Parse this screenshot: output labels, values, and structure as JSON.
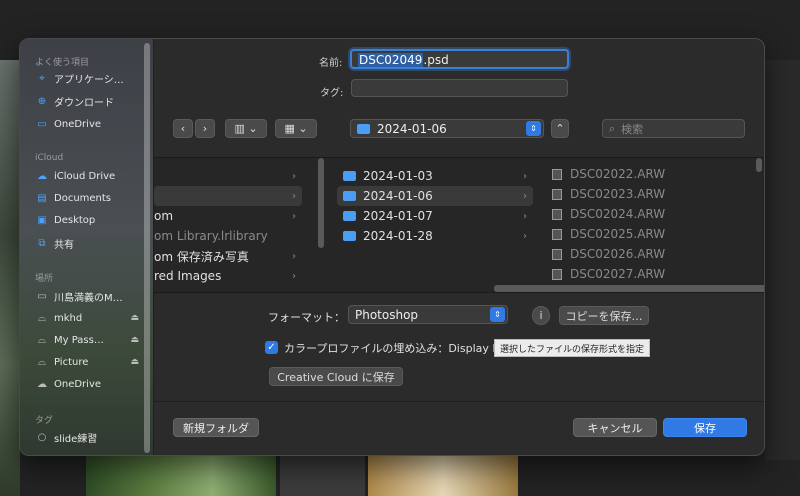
{
  "sidebar": {
    "favorites_title": "よく使う項目",
    "favorites": [
      {
        "label": "アプリケーシ…",
        "icon": "applications-icon"
      },
      {
        "label": "ダウンロード",
        "icon": "download-icon"
      },
      {
        "label": "OneDrive",
        "icon": "folder-icon"
      }
    ],
    "icloud_title": "iCloud",
    "icloud": [
      {
        "label": "iCloud Drive",
        "icon": "cloud-icon"
      },
      {
        "label": "Documents",
        "icon": "document-icon"
      },
      {
        "label": "Desktop",
        "icon": "desktop-icon"
      },
      {
        "label": "共有",
        "icon": "shared-folder-icon"
      }
    ],
    "locations_title": "場所",
    "locations": [
      {
        "label": "川島満義のM…",
        "icon": "laptop-icon"
      },
      {
        "label": "mkhd",
        "icon": "drive-icon"
      },
      {
        "label": "My Pass…",
        "icon": "drive-icon"
      },
      {
        "label": "Picture",
        "icon": "drive-icon"
      },
      {
        "label": "OneDrive",
        "icon": "cloud-icon"
      }
    ],
    "tags_title": "タグ",
    "tags": [
      {
        "label": "slide練習",
        "icon": "tag-icon"
      }
    ]
  },
  "save": {
    "name_label": "名前:",
    "name_selected": "DSC02049",
    "name_ext": ".psd",
    "tags_label": "タグ:"
  },
  "toolbar": {
    "location": "2024-01-06",
    "search_placeholder": "検索"
  },
  "browser": {
    "col1": [
      {
        "label": "",
        "selected": false
      },
      {
        "label": "",
        "selected": true
      },
      {
        "label": "om",
        "selected": false
      },
      {
        "label": "om Library.lrlibrary",
        "selected": false,
        "dim": true
      },
      {
        "label": "om 保存済み写真",
        "selected": false
      },
      {
        "label": "red Images",
        "selected": false
      }
    ],
    "col2": [
      {
        "label": "2024-01-03",
        "selected": false
      },
      {
        "label": "2024-01-06",
        "selected": true
      },
      {
        "label": "2024-01-07",
        "selected": false
      },
      {
        "label": "2024-01-28",
        "selected": false
      }
    ],
    "col3": [
      "DSC02022.ARW",
      "DSC02023.ARW",
      "DSC02024.ARW",
      "DSC02025.ARW",
      "DSC02026.ARW",
      "DSC02027.ARW"
    ]
  },
  "options": {
    "format_label": "フォーマット：",
    "format_value": "Photoshop",
    "info_icon": "i",
    "save_copy": "コピーを保存…",
    "color_profile": "カラープロファイルの埋め込み：Display P",
    "tooltip": "選択したファイルの保存形式を指定",
    "cc_save": "Creative Cloud に保存"
  },
  "footer": {
    "new_folder": "新規フォルダ",
    "cancel": "キャンセル",
    "save": "保存"
  }
}
